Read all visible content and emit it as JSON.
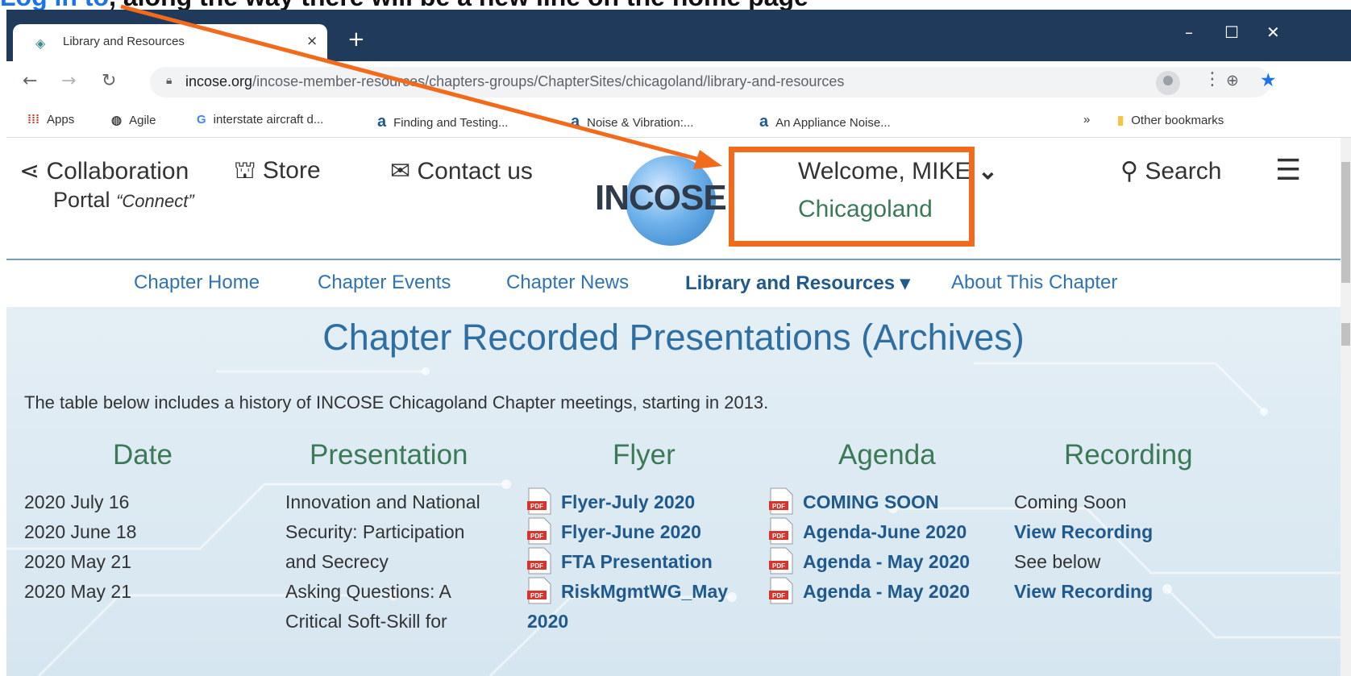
{
  "caption": {
    "text_a": "",
    "text_b": ", along the way there will be a new line on the home page",
    "highlight": "Log in to"
  },
  "browser": {
    "tab_title": "Library and Resources",
    "new_tab": "+",
    "tab_close": "×",
    "url_host": "incose.org",
    "url_path": "/incose-member-resources/chapters-groups/ChapterSites/chicagoland/library-and-resources",
    "window_min": "–",
    "window_max": "☐",
    "window_close": "✕"
  },
  "bookmarks": {
    "apps": "Apps",
    "agile": "Agile",
    "google_item": "interstate aircraft d...",
    "finding": "Finding and Testing...",
    "noise": "Noise & Vibration:...",
    "appliance": "An Appliance Noise...",
    "more": "»",
    "other": "Other bookmarks"
  },
  "header": {
    "collab_line1": "Collaboration",
    "collab_line2": "Portal",
    "collab_connect": "“Connect”",
    "store": "Store",
    "contact": "Contact us",
    "logo": "INCOSE",
    "welcome": "Welcome, MIKE",
    "chapter": "Chicagoland",
    "search": "Search"
  },
  "chapter_nav": {
    "home": "Chapter Home",
    "events": "Chapter Events",
    "news": "Chapter News",
    "library": "Library and Resources ▾",
    "about": "About This Chapter"
  },
  "content": {
    "title": "Chapter Recorded Presentations (Archives)",
    "intro": "The table below includes a history of INCOSE Chicagoland Chapter meetings, starting in 2013.",
    "columns": {
      "date": "Date",
      "presentation": "Presentation",
      "flyer": "Flyer",
      "agenda": "Agenda",
      "recording": "Recording"
    },
    "dates": [
      "2020 July 16",
      "2020 June 18",
      "2020 May 21",
      "2020 May 21"
    ],
    "presentation_lines": [
      "Innovation and National",
      "Security: Participation",
      "and Secrecy",
      "Asking Questions: A",
      "Critical Soft-Skill for"
    ],
    "flyers": [
      "Flyer-July 2020",
      "Flyer-June 2020",
      "FTA Presentation",
      "RiskMgmtWG_May"
    ],
    "flyer_wrap": "2020",
    "agendas": [
      "COMING SOON",
      "Agenda-June 2020",
      "Agenda - May 2020",
      "Agenda - May 2020"
    ],
    "recordings": [
      "Coming Soon",
      "View Recording",
      "See below",
      "View Recording"
    ]
  },
  "colors": {
    "accent_orange": "#f26b1d",
    "title_blue": "#2e6fa3",
    "heading_green": "#3b7a57",
    "link_blue": "#1f5a8e",
    "browser_frame": "#203a5c"
  }
}
